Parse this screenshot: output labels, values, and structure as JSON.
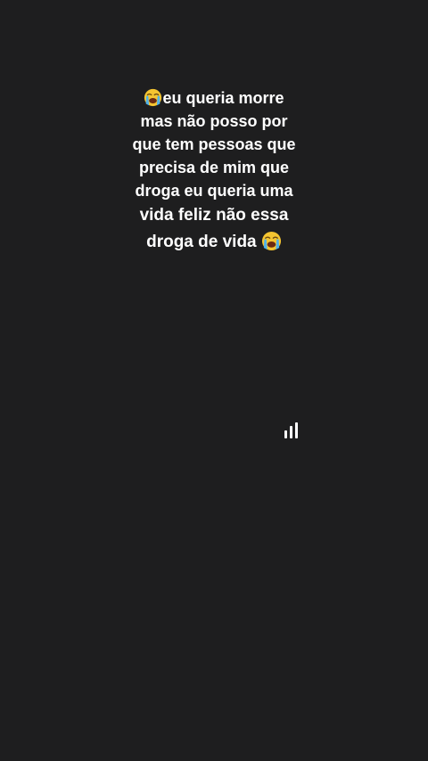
{
  "story": {
    "emoji_icon": "loudly-crying-face-icon",
    "lines": [
      "eu queria morre",
      "mas não posso por",
      "que tem pessoas que",
      "precisa de mim que",
      "droga eu queria uma",
      "vida feliz não essa",
      "droga de vida"
    ]
  },
  "indicator": {
    "icon": "signal-bars-icon"
  },
  "colors": {
    "background": "#1e1e1f",
    "text": "#ffffff"
  }
}
